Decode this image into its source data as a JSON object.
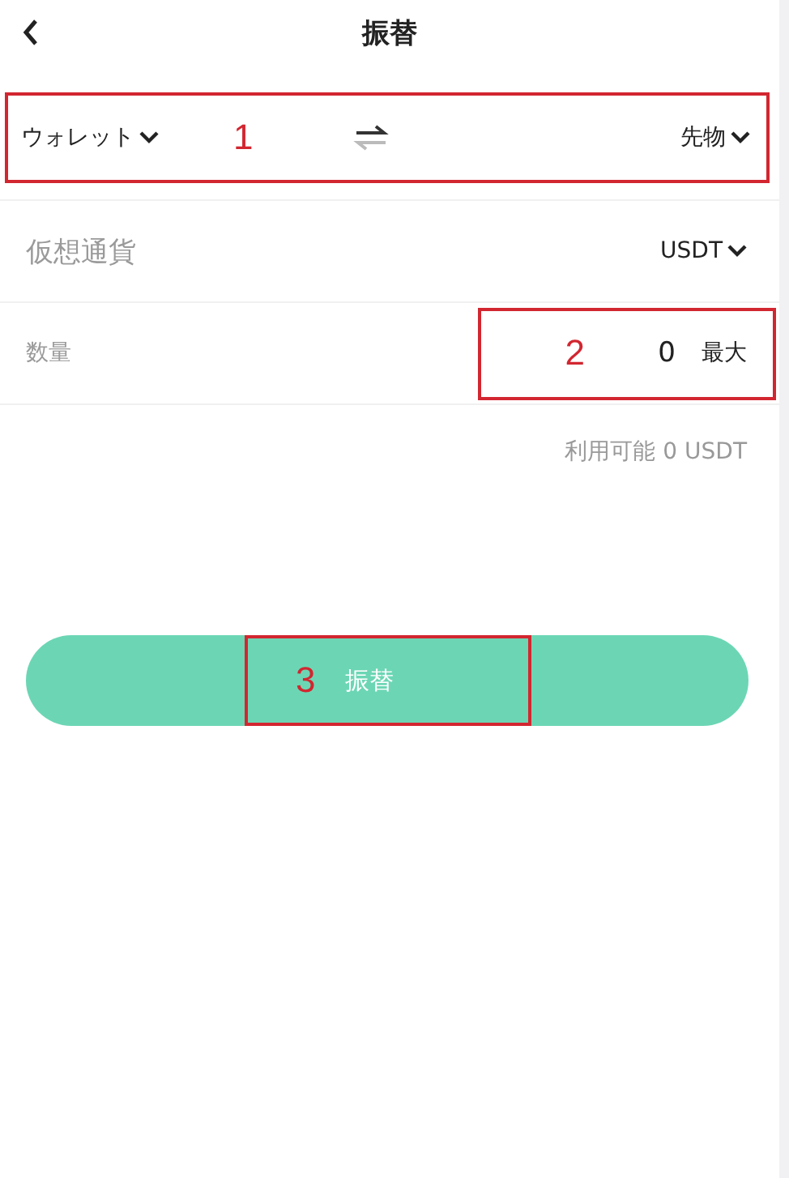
{
  "header": {
    "title": "振替"
  },
  "transfer": {
    "from": "ウォレット",
    "to": "先物",
    "annotation": "1"
  },
  "currency": {
    "label": "仮想通貨",
    "value": "USDT"
  },
  "amount": {
    "label": "数量",
    "value": "0",
    "max": "最大",
    "annotation": "2"
  },
  "available": "利用可能 0 USDT",
  "submit": {
    "label": "振替",
    "annotation": "3"
  }
}
